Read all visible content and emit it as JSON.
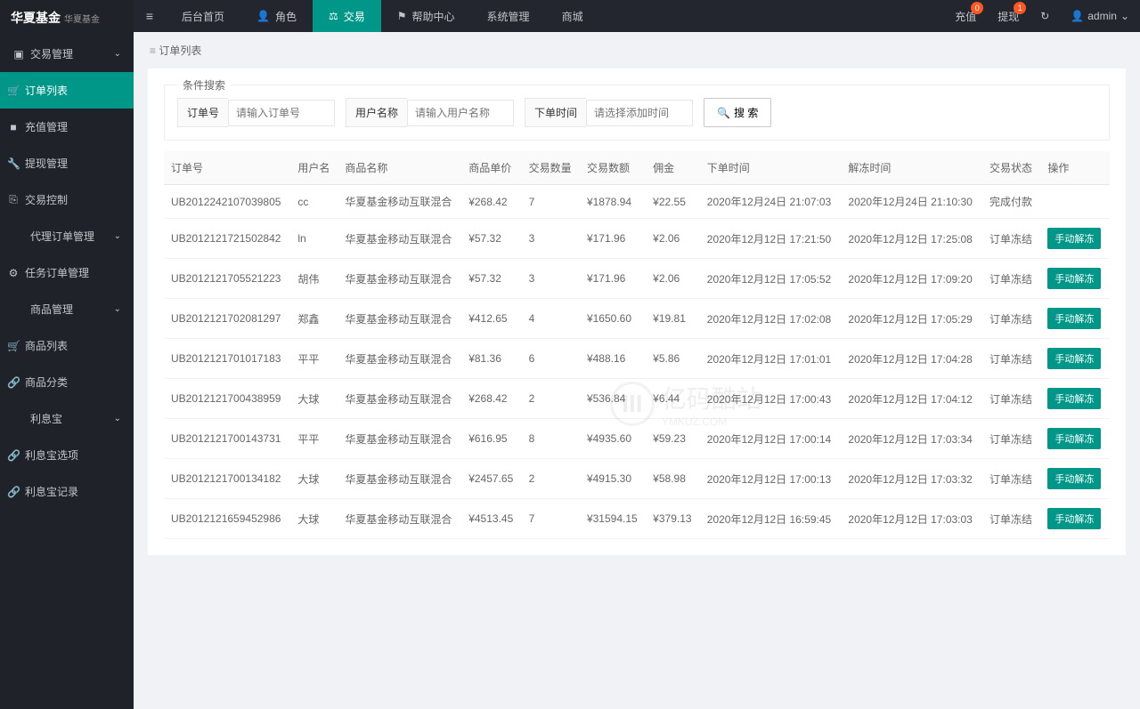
{
  "brand": {
    "main": "华夏基金",
    "sub": "华夏基金"
  },
  "sidebar": {
    "groups": [
      {
        "label": "交易管理",
        "icon": "▣",
        "expandable": true
      },
      {
        "label": "订单列表",
        "icon": "🛒",
        "active": true,
        "sub": true
      },
      {
        "label": "充值管理",
        "icon": "■",
        "sub": true
      },
      {
        "label": "提现管理",
        "icon": "🔧",
        "sub": true
      },
      {
        "label": "交易控制",
        "icon": "⎘",
        "sub": true
      },
      {
        "label": "代理订单管理",
        "icon": "",
        "expandable": true
      },
      {
        "label": "任务订单管理",
        "icon": "⚙",
        "sub": true
      },
      {
        "label": "商品管理",
        "icon": "",
        "expandable": true
      },
      {
        "label": "商品列表",
        "icon": "🛒",
        "sub": true
      },
      {
        "label": "商品分类",
        "icon": "🔗",
        "sub": true
      },
      {
        "label": "利息宝",
        "icon": "",
        "expandable": true
      },
      {
        "label": "利息宝选项",
        "icon": "🔗",
        "sub": true
      },
      {
        "label": "利息宝记录",
        "icon": "🔗",
        "sub": true
      }
    ]
  },
  "topnav": [
    {
      "label": "后台首页",
      "icon": ""
    },
    {
      "label": "角色",
      "icon": "👤"
    },
    {
      "label": "交易",
      "icon": "⚖",
      "active": true
    },
    {
      "label": "帮助中心",
      "icon": "⚑"
    },
    {
      "label": "系统管理",
      "icon": ""
    },
    {
      "label": "商城",
      "icon": ""
    }
  ],
  "topright": {
    "recharge": {
      "label": "充值",
      "badge": "0"
    },
    "withdraw": {
      "label": "提现",
      "badge": "1"
    },
    "refresh_icon": "↻",
    "user": {
      "icon": "👤",
      "name": "admin",
      "chev": "⌄"
    }
  },
  "breadcrumb": "订单列表",
  "search": {
    "legend": "条件搜索",
    "order_label": "订单号",
    "order_placeholder": "请输入订单号",
    "user_label": "用户名称",
    "user_placeholder": "请输入用户名称",
    "time_label": "下单时间",
    "time_placeholder": "请选择添加时间",
    "btn_icon": "🔍",
    "btn_label": "搜 索"
  },
  "table": {
    "headers": [
      "订单号",
      "用户名",
      "商品名称",
      "商品单价",
      "交易数量",
      "交易数额",
      "佣金",
      "下单时间",
      "解冻时间",
      "交易状态",
      "操作"
    ],
    "rows": [
      {
        "c": [
          "UB2012242107039805",
          "cc",
          "华夏基金移动互联混合",
          "¥268.42",
          "7",
          "¥1878.94",
          "¥22.55",
          "2020年12月24日 21:07:03",
          "2020年12月24日 21:10:30",
          "完成付款"
        ],
        "action": ""
      },
      {
        "c": [
          "UB2012121721502842",
          "ln",
          "华夏基金移动互联混合",
          "¥57.32",
          "3",
          "¥171.96",
          "¥2.06",
          "2020年12月12日 17:21:50",
          "2020年12月12日 17:25:08",
          "订单冻结"
        ],
        "action": "手动解冻"
      },
      {
        "c": [
          "UB2012121705521223",
          "胡伟",
          "华夏基金移动互联混合",
          "¥57.32",
          "3",
          "¥171.96",
          "¥2.06",
          "2020年12月12日 17:05:52",
          "2020年12月12日 17:09:20",
          "订单冻结"
        ],
        "action": "手动解冻"
      },
      {
        "c": [
          "UB2012121702081297",
          "郑鑫",
          "华夏基金移动互联混合",
          "¥412.65",
          "4",
          "¥1650.60",
          "¥19.81",
          "2020年12月12日 17:02:08",
          "2020年12月12日 17:05:29",
          "订单冻结"
        ],
        "action": "手动解冻"
      },
      {
        "c": [
          "UB2012121701017183",
          "平平",
          "华夏基金移动互联混合",
          "¥81.36",
          "6",
          "¥488.16",
          "¥5.86",
          "2020年12月12日 17:01:01",
          "2020年12月12日 17:04:28",
          "订单冻结"
        ],
        "action": "手动解冻"
      },
      {
        "c": [
          "UB2012121700438959",
          "大球",
          "华夏基金移动互联混合",
          "¥268.42",
          "2",
          "¥536.84",
          "¥6.44",
          "2020年12月12日 17:00:43",
          "2020年12月12日 17:04:12",
          "订单冻结"
        ],
        "action": "手动解冻"
      },
      {
        "c": [
          "UB2012121700143731",
          "平平",
          "华夏基金移动互联混合",
          "¥616.95",
          "8",
          "¥4935.60",
          "¥59.23",
          "2020年12月12日 17:00:14",
          "2020年12月12日 17:03:34",
          "订单冻结"
        ],
        "action": "手动解冻"
      },
      {
        "c": [
          "UB2012121700134182",
          "大球",
          "华夏基金移动互联混合",
          "¥2457.65",
          "2",
          "¥4915.30",
          "¥58.98",
          "2020年12月12日 17:00:13",
          "2020年12月12日 17:03:32",
          "订单冻结"
        ],
        "action": "手动解冻"
      },
      {
        "c": [
          "UB2012121659452986",
          "大球",
          "华夏基金移动互联混合",
          "¥4513.45",
          "7",
          "¥31594.15",
          "¥379.13",
          "2020年12月12日 16:59:45",
          "2020年12月12日 17:03:03",
          "订单冻结"
        ],
        "action": "手动解冻"
      }
    ]
  },
  "watermark": {
    "text1": "亿码酷站",
    "text2": "YMKUZ.COM"
  }
}
